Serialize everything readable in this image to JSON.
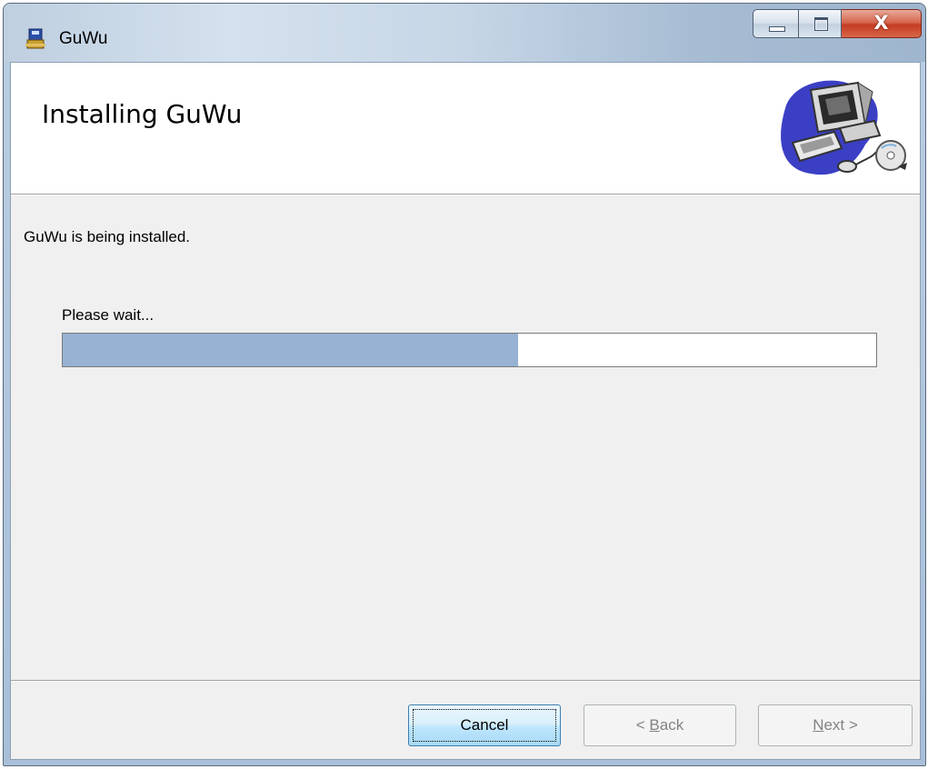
{
  "window": {
    "title": "GuWu",
    "buttons": {
      "minimize": "minimize-icon",
      "maximize": "maximize-icon",
      "close": "X"
    }
  },
  "banner": {
    "title": "Installing GuWu",
    "image": "computer-disc-icon"
  },
  "body": {
    "status": "GuWu is being installed.",
    "wait_label": "Please wait...",
    "progress_fraction": 0.56
  },
  "footer": {
    "cancel": "Cancel",
    "back_prefix": "< ",
    "back_key": "B",
    "back_rest": "ack",
    "next_key": "N",
    "next_rest": "ext >"
  },
  "colors": {
    "progress_fill": "#97b2d2",
    "client_bg": "#f0f0f0"
  }
}
